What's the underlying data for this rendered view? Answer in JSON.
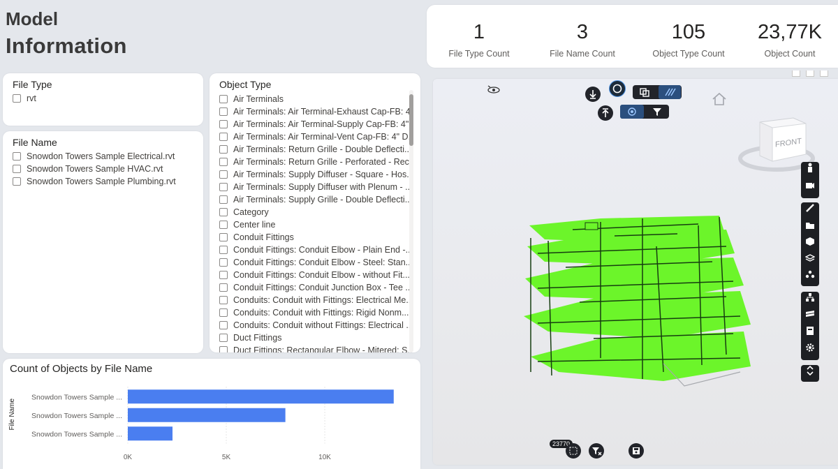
{
  "page_title": {
    "line1": "Model",
    "line2": "Information"
  },
  "kpis": [
    {
      "value": "1",
      "label": "File Type Count"
    },
    {
      "value": "3",
      "label": "File Name Count"
    },
    {
      "value": "105",
      "label": "Object Type Count"
    },
    {
      "value": "23,77K",
      "label": "Object Count"
    }
  ],
  "file_type": {
    "title": "File Type",
    "options": [
      "rvt"
    ]
  },
  "file_name": {
    "title": "File Name",
    "options": [
      "Snowdon Towers Sample Electrical.rvt",
      "Snowdon Towers Sample HVAC.rvt",
      "Snowdon Towers Sample Plumbing.rvt"
    ]
  },
  "object_type": {
    "title": "Object Type",
    "options": [
      "Air Terminals",
      "Air Terminals: Air Terminal-Exhaust Cap-FB: 4...",
      "Air Terminals: Air Terminal-Supply Cap-FB: 4\"...",
      "Air Terminals: Air Terminal-Vent Cap-FB: 4\" D...",
      "Air Terminals: Return Grille - Double Deflecti...",
      "Air Terminals: Return Grille - Perforated - Rec...",
      "Air Terminals: Supply Diffuser - Square - Hos...",
      "Air Terminals: Supply Diffuser with Plenum - ...",
      "Air Terminals: Supply Grille - Double Deflecti...",
      "Category",
      "Center line",
      "Conduit Fittings",
      "Conduit Fittings: Conduit Elbow - Plain End -...",
      "Conduit Fittings: Conduit Elbow - Steel: Stan...",
      "Conduit Fittings: Conduit Elbow - without Fit...",
      "Conduit Fittings: Conduit Junction Box - Tee ...",
      "Conduits: Conduit with Fittings: Electrical Me...",
      "Conduits: Conduit with Fittings: Rigid Nonm...",
      "Conduits: Conduit without Fittings: Electrical ...",
      "Duct Fittings",
      "Duct Fittings: Rectangular Elbow - Mitered: S..."
    ]
  },
  "chart_data": {
    "type": "bar",
    "orientation": "horizontal",
    "title": "Count of Objects by File Name",
    "ylabel": "File Name",
    "xlabel": "",
    "categories": [
      "Snowdon Towers Sample ...",
      "Snowdon Towers Sample ...",
      "Snowdon Towers Sample ..."
    ],
    "values": [
      13500,
      8000,
      2270
    ],
    "xlim": [
      0,
      14500
    ],
    "xticks": [
      {
        "value": 0,
        "label": "0K"
      },
      {
        "value": 5000,
        "label": "5K"
      },
      {
        "value": 10000,
        "label": "10K"
      }
    ],
    "bar_color": "#4a7ef0",
    "grid": true
  },
  "viewer": {
    "cube_label": "FRONT",
    "selection_count": "23770",
    "model_color": "#6cf52a",
    "toolbar_icons": [
      "arrow-down-icon",
      "orbit-icon",
      "section-box-icon",
      "hatch-icon",
      "arrow-up-icon",
      "focus-icon",
      "filter-icon"
    ],
    "right_toolbar_groups": [
      [
        "person-icon",
        "camera-icon"
      ],
      [
        "measure-icon",
        "folder-icon",
        "cube-icon",
        "layers-icon",
        "explode-icon"
      ],
      [
        "tree-icon",
        "stack-icon",
        "properties-icon",
        "settings-icon"
      ],
      [
        "expand-icon"
      ]
    ]
  },
  "colors": {
    "background": "#e4e7ec",
    "card": "#ffffff",
    "bar": "#4a7ef0",
    "model": "#6cf52a"
  }
}
